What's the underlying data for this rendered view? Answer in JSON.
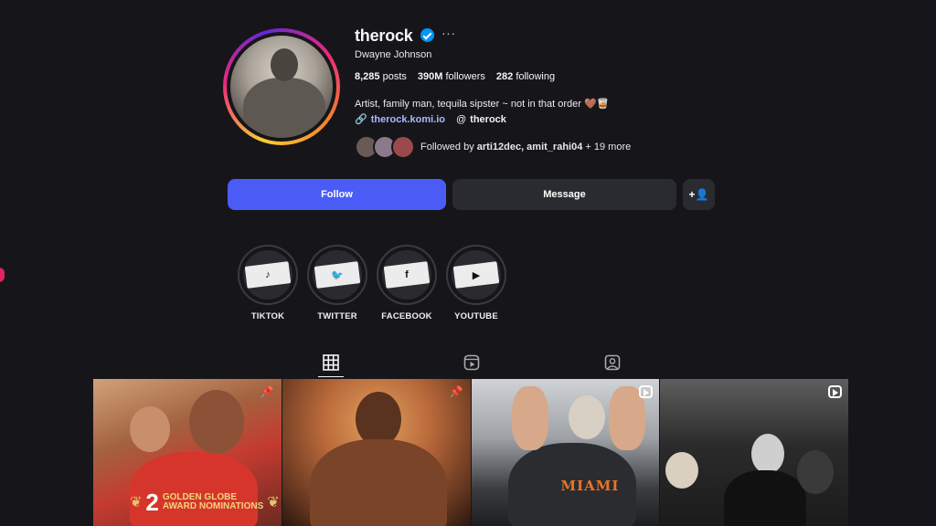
{
  "profile": {
    "username": "therock",
    "full_name": "Dwayne Johnson",
    "more_icon": "···",
    "stats": {
      "posts_count": "8,285",
      "posts_label": "posts",
      "followers_count": "390M",
      "followers_label": "followers",
      "following_count": "282",
      "following_label": "following"
    },
    "bio": "Artist, family man, tequila sipster ~ not in that order 🤎🥃",
    "link_url": "therock.komi.io",
    "threads_handle": "therock",
    "followed_by": {
      "prefix": "Followed by",
      "names": "arti12dec, amit_rahi04",
      "suffix": "+ 19 more"
    }
  },
  "actions": {
    "follow_label": "Follow",
    "message_label": "Message",
    "add_user_icon": "+👤"
  },
  "highlights": [
    {
      "label": "TIKTOK",
      "glyph": "♪",
      "icon": "tiktok-icon"
    },
    {
      "label": "TWITTER",
      "glyph": "🐦",
      "icon": "twitter-icon"
    },
    {
      "label": "FACEBOOK",
      "glyph": "f",
      "icon": "facebook-icon"
    },
    {
      "label": "YOUTUBE",
      "glyph": "▶",
      "icon": "youtube-icon"
    }
  ],
  "tabs": [
    {
      "name": "posts",
      "icon": "grid-icon",
      "active": true
    },
    {
      "name": "reels",
      "icon": "reels-icon",
      "active": false
    },
    {
      "name": "tagged",
      "icon": "tagged-icon",
      "active": false
    }
  ],
  "posts": [
    {
      "badge": "pin",
      "overlay_number": "2",
      "overlay_line1": "GOLDEN GLOBE",
      "overlay_line2": "AWARD NOMINATIONS"
    },
    {
      "badge": "pin"
    },
    {
      "badge": "reel",
      "shirt_text": "MIAMI"
    },
    {
      "badge": "reel"
    }
  ],
  "colors": {
    "background": "#16161a",
    "follow_button": "#4a5cf5",
    "secondary_button": "#2a2b30",
    "verified": "#0095f6",
    "link": "#a8b8ff"
  }
}
